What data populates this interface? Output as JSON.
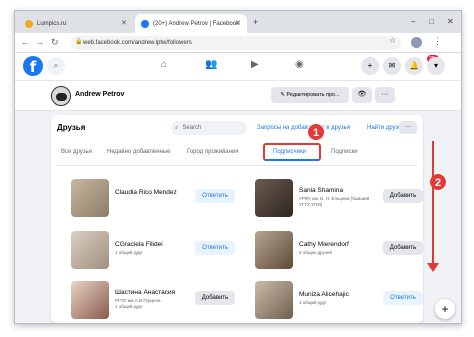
{
  "browser": {
    "tabs": [
      {
        "title": "Lumpics.ru",
        "fav_color": "#f5a623"
      },
      {
        "title": "(20+) Andrew Petrov | Facebook",
        "fav_color": "#1877f2"
      }
    ],
    "url": "web.facebook.com/andrew.lptw/followers",
    "new_tab": "+",
    "controls": [
      "–",
      "□",
      "✕"
    ]
  },
  "fb_nav": {
    "logo": "f",
    "notifications_badge": "20+"
  },
  "profile": {
    "name": "Andrew Petrov",
    "edit_label": "Редактировать про...",
    "view_icon": "eye-icon",
    "more": "···"
  },
  "friends_card": {
    "title": "Друзья",
    "search_placeholder": "Search",
    "link_requests": "Запросы на добавление в друзья",
    "link_find": "Найти друзей",
    "more": "···",
    "tabs": [
      "Все друзья",
      "Недавно добавленные",
      "Город проживания",
      "Подписчики",
      "Подписки"
    ],
    "active_tab": "Подписчики",
    "people": [
      {
        "name": "Claudia Rico Mendez",
        "sub": "",
        "button": "Ответить"
      },
      {
        "name": "Sania Shamina",
        "sub": "УРФУ им. Б. Н. Ельцина (бывший\nУГТУ-УПИ)",
        "button": "Добавить"
      },
      {
        "name": "CGraciela Filidei",
        "sub": "1 общий друг",
        "button": "Ответить"
      },
      {
        "name": "Cathy Mierendorf",
        "sub": "5 общих друзей",
        "button": "Добавить"
      },
      {
        "name": "Шастина Анастасия",
        "sub": "РГПУ им.А.И.Герцена\n1 общий друг",
        "button": "Добавить"
      },
      {
        "name": "Muniza Alicehajic",
        "sub": "1 общий друг",
        "button": "Ответить"
      }
    ]
  },
  "annotations": {
    "step1": "1",
    "step2": "2"
  },
  "colors": {
    "accent": "#1877f2",
    "annotation": "#e53935"
  }
}
